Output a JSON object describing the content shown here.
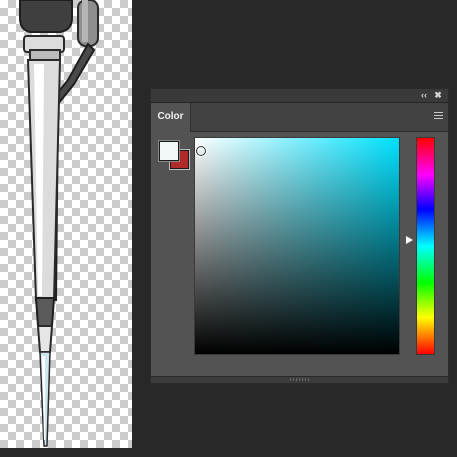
{
  "panel": {
    "tab_label": "Color",
    "collapse_glyph": "‹‹",
    "close_glyph": "✖",
    "icons": [
      "double-chevron-left-icon",
      "close-icon",
      "panel-menu-icon"
    ]
  },
  "colors": {
    "foreground": "#f2f8f9",
    "background": "#b02a2a",
    "field_hue": "#00e1ff",
    "panel_bg": "#535353",
    "workspace_bg": "#282828"
  }
}
